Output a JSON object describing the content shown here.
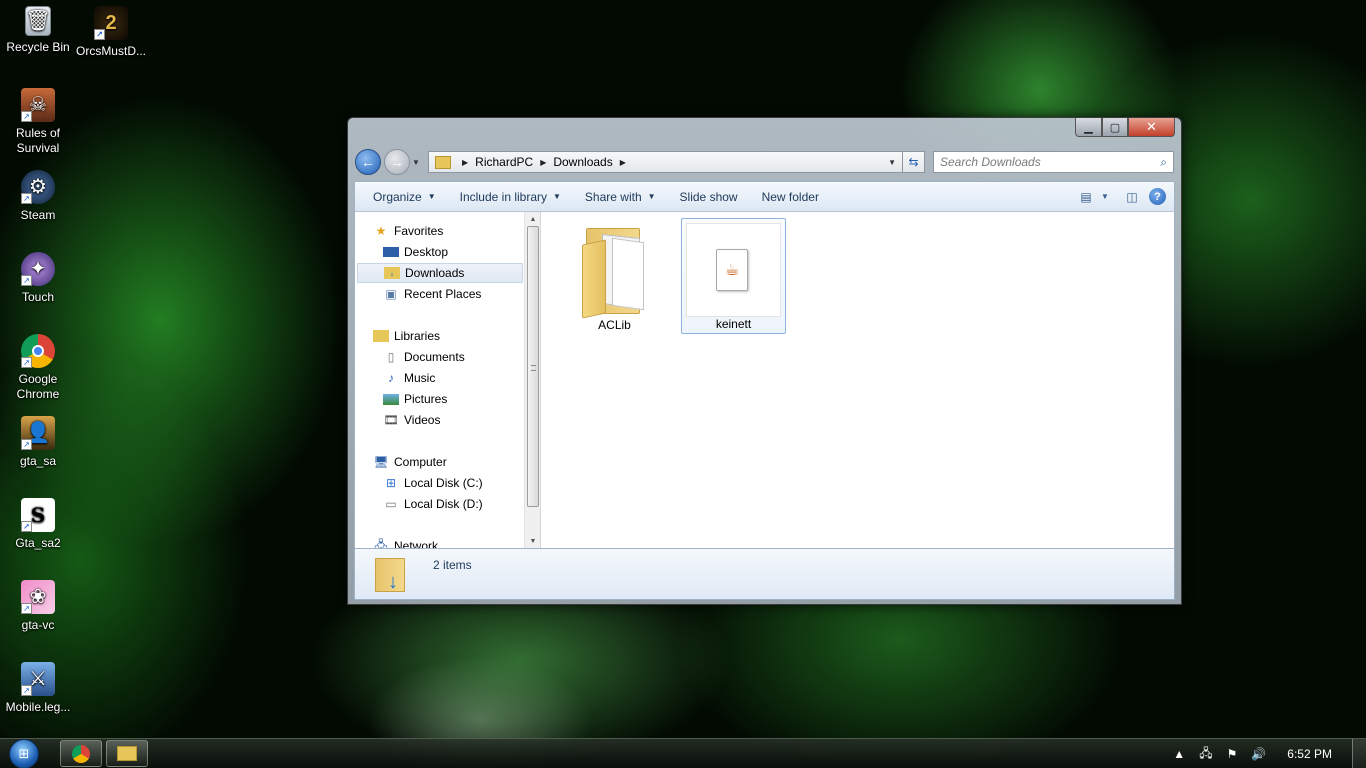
{
  "desktop": {
    "icons": [
      {
        "label": "Recycle Bin",
        "icon": "recycle-bin-icon"
      },
      {
        "label": "OrcsMustD...",
        "icon": "game-icon"
      },
      {
        "label": "Rules of Survival",
        "icon": "game-icon"
      },
      {
        "label": "Steam",
        "icon": "steam-icon"
      },
      {
        "label": "Touch",
        "icon": "game-icon"
      },
      {
        "label": "Google Chrome",
        "icon": "chrome-icon"
      },
      {
        "label": "gta_sa",
        "icon": "game-icon"
      },
      {
        "label": "Gta_sa2",
        "icon": "game-icon"
      },
      {
        "label": "gta-vc",
        "icon": "game-icon"
      },
      {
        "label": "Mobile.leg...",
        "icon": "game-icon"
      }
    ]
  },
  "window": {
    "breadcrumb": [
      "RichardPC",
      "Downloads"
    ],
    "search_placeholder": "Search Downloads",
    "toolbar": {
      "organize": "Organize",
      "include_in_library": "Include in library",
      "share_with": "Share with",
      "slide_show": "Slide show",
      "new_folder": "New folder"
    },
    "nav": {
      "favorites": "Favorites",
      "desktop": "Desktop",
      "downloads": "Downloads",
      "recent_places": "Recent Places",
      "libraries": "Libraries",
      "documents": "Documents",
      "music": "Music",
      "pictures": "Pictures",
      "videos": "Videos",
      "computer": "Computer",
      "local_c": "Local Disk (C:)",
      "local_d": "Local Disk (D:)",
      "network": "Network"
    },
    "files": [
      {
        "name": "ACLib",
        "type": "folder"
      },
      {
        "name": "keinett",
        "type": "java-file",
        "selected": true
      }
    ],
    "status": {
      "count": "2 items"
    }
  },
  "taskbar": {
    "clock": "6:52 PM"
  },
  "colors": {
    "toolbar_text": "#1e395b",
    "selection_border": "#8cb4e0",
    "wallpaper_green": "#3cdc3c"
  }
}
